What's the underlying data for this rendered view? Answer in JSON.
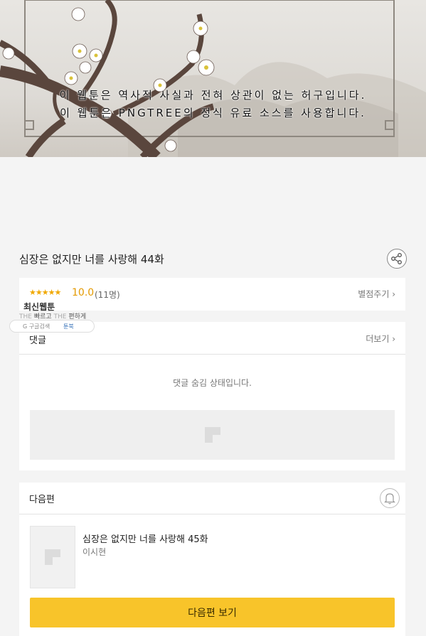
{
  "banner": {
    "disclaimer_line1": "이 웹툰은 역사적 사실과 전혀 상관이 없는 허구입니다.",
    "disclaimer_line2": "이 웹툰은 PNGTREE의 정식 유료 소스를 사용합니다."
  },
  "episode": {
    "title": "심장은 없지만 너를 사랑해 44화"
  },
  "rating": {
    "stars": "★★★★★",
    "value": "10.0",
    "count": "(11명)",
    "rate_link": "별점주기 ›"
  },
  "overlay": {
    "title": "최신웹툰",
    "tag_prefix": "THE",
    "tag_fast": "빠르고",
    "tag_prefix2": "THE",
    "tag_easy": "편하게",
    "pill_search": "G 구글검색",
    "pill_toonbook": "툰북"
  },
  "comments": {
    "heading": "댓글",
    "more_link": "더보기 ›",
    "hidden_message": "댓글 숨김 상태입니다."
  },
  "next_episode": {
    "heading": "다음편",
    "title": "심장은 없지만 너를 사랑해 45화",
    "author": "이시현",
    "button_label": "다음편 보기"
  },
  "colors": {
    "accent_yellow": "#f8c42a",
    "star_orange": "#f0a800",
    "background": "#f4f4f4"
  },
  "icons": [
    "share-icon",
    "bell-icon",
    "image-placeholder-icon"
  ]
}
